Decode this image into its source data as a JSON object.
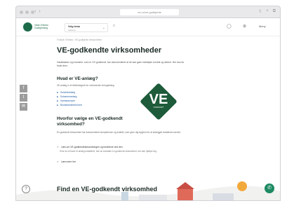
{
  "browser": {
    "url": "ve.no/ve-godkjente",
    "nav_back": "‹",
    "nav_forward": "›",
    "actions": [
      "⇪",
      "+",
      "⧉"
    ]
  },
  "header": {
    "logo_text_1": "Viken Elektro",
    "logo_text_2": "Godkjenning",
    "selector_label": "Velg tema",
    "selector_sub": "Sektorer",
    "search_icon": "search-icon",
    "menu_label": "Meny"
  },
  "breadcrumb": "Forside / Elektro / VE-godkjente virksomheter",
  "title": "VE-godkendte virksomheder",
  "intro": "Installatører og montører, som er VE-godkendt, har dokumenteret at de kan gøre elarbejde korrekt og sikkert. Her kan du finde dem.",
  "social": [
    "f",
    "t",
    "✉"
  ],
  "what": {
    "heading": "Hvad er VE-anlæg?",
    "text": "VE-anlæg er et fællesbegreb for vedvarende energianlæg.",
    "links": [
      "Solcelleanlæg",
      "Solvarmeanlæg",
      "Varmepumper",
      "Biomassekedel/ovne"
    ]
  },
  "badge": {
    "letter": "VE",
    "sub": "GODKENDT"
  },
  "why": {
    "heading": "Hvorfor vælge en VE-godkendt virksomhed?",
    "text": "En godkendt virksomhed har dokumenteret kompetencer og kvalitet, som giver dig tryghed for at anlægget installeres korrekt.",
    "check1": "Læs om VE-godkendelsesordningen og fordelene ved den",
    "subtext": "Hvis du vil have et anlæg installeret, bør du kontakte en godkendt virksomhed, der kan hjælpe dig.",
    "check2": "Læs mere her"
  },
  "find_heading": "Find en VE-godkendt virksomhed",
  "help_icon": "help-icon",
  "chat_icon": "chat-icon",
  "colors": {
    "brand": "#1e6b4a",
    "badge": "#1d5b3a",
    "link": "#2860a8",
    "chat": "#1e8a63"
  }
}
